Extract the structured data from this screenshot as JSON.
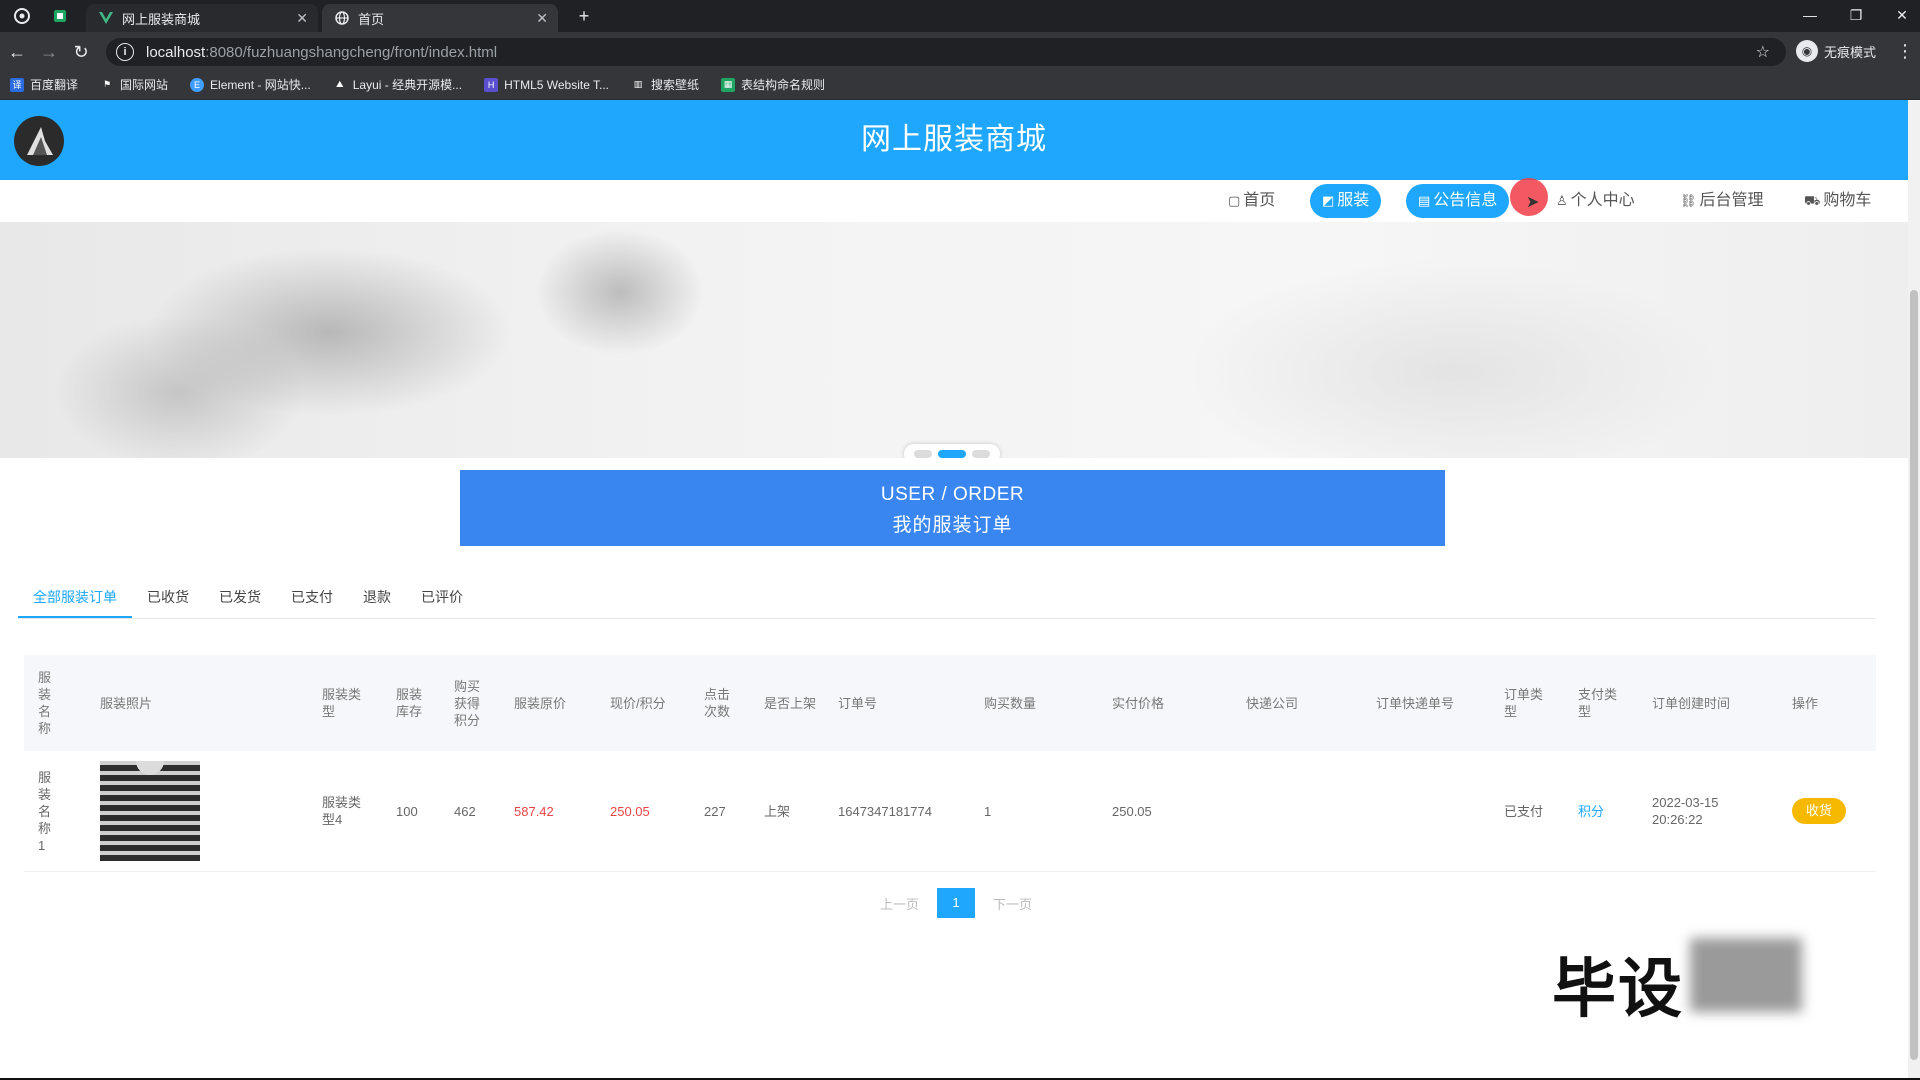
{
  "browser": {
    "tabs": [
      {
        "title": "网上服装商城"
      },
      {
        "title": "首页"
      }
    ],
    "new_tab": "+",
    "url_host": "localhost",
    "url_rest": ":8080/fuzhuangshangcheng/front/index.html",
    "incognito_label": "无痕模式",
    "bookmarks": [
      "百度翻译",
      "国际网站",
      "Element - 网站快...",
      "Layui - 经典开源模...",
      "HTML5 Website T...",
      "搜索壁纸",
      "表结构命名规则"
    ]
  },
  "site": {
    "title": "网上服装商城",
    "nav": [
      "首页",
      "服装",
      "公告信息",
      "个人中心",
      "后台管理",
      "购物车"
    ]
  },
  "section": {
    "title_en": "USER / ORDER",
    "title_cn": "我的服装订单"
  },
  "order_tabs": [
    "全部服装订单",
    "已收货",
    "已发货",
    "已支付",
    "退款",
    "已评价"
  ],
  "table": {
    "headers": [
      "服装名称",
      "服装照片",
      "服装类型",
      "服装库存",
      "购买获得积分",
      "服装原价",
      "现价/积分",
      "点击次数",
      "是否上架",
      "订单号",
      "购买数量",
      "实付价格",
      "快递公司",
      "订单快递单号",
      "订单类型",
      "支付类型",
      "订单创建时间",
      "操作"
    ],
    "rows": [
      {
        "name": "服装名称1",
        "type": "服装类型4",
        "stock": "100",
        "points": "462",
        "original_price": "587.42",
        "current_price": "250.05",
        "clicks": "227",
        "on_shelf": "上架",
        "order_no": "1647347181774",
        "quantity": "1",
        "paid": "250.05",
        "express_company": "",
        "express_no": "",
        "order_type": "已支付",
        "pay_type": "积分",
        "created": "2022-03-15 20:26:22",
        "action": "收货"
      }
    ]
  },
  "pager": {
    "prev": "上一页",
    "current": "1",
    "next": "下一页"
  },
  "watermark": "毕设",
  "colors": {
    "brand": "#1ea7fd",
    "section_box": "#3a86f0",
    "price_red": "#e64545",
    "action_yellow": "#f7b900"
  }
}
